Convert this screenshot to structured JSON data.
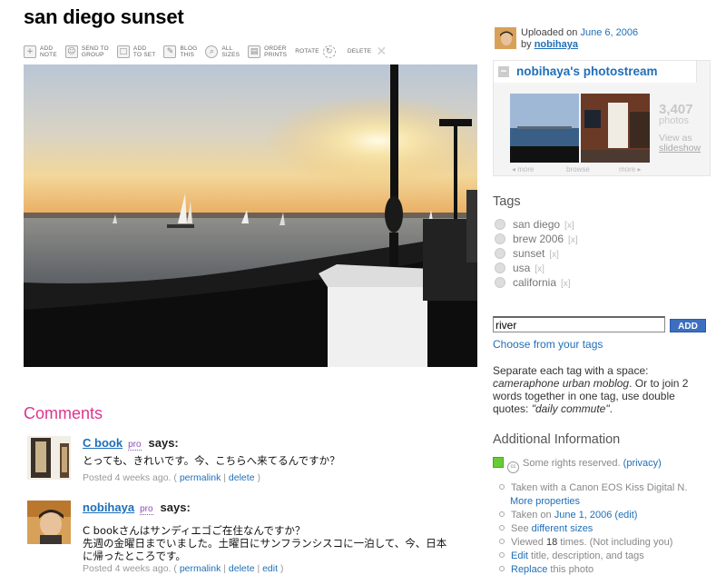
{
  "title": "san diego sunset",
  "toolbar": [
    {
      "icon": "add-note-icon",
      "line1": "ADD",
      "line2": "NOTE"
    },
    {
      "icon": "send-to-group-icon",
      "line1": "SEND TO",
      "line2": "GROUP"
    },
    {
      "icon": "add-to-set-icon",
      "line1": "ADD",
      "line2": "TO SET"
    },
    {
      "icon": "blog-this-icon",
      "line1": "BLOG",
      "line2": "THIS"
    },
    {
      "icon": "all-sizes-icon",
      "line1": "ALL",
      "line2": "SIZES"
    },
    {
      "icon": "order-prints-icon",
      "line1": "ORDER",
      "line2": "PRINTS"
    },
    {
      "icon": "rotate-icon",
      "line1": "ROTATE",
      "line2": ""
    },
    {
      "icon": "delete-icon",
      "line1": "DELETE",
      "line2": ""
    }
  ],
  "comments": {
    "heading": "Comments",
    "items": [
      {
        "user": "C book",
        "pro": "pro",
        "says": "says:",
        "body": "とっても、きれいです。今、こちらへ来てるんですか？",
        "posted": "Posted 4 weeks ago. (",
        "links": [
          "permalink",
          "delete"
        ],
        "close": ")"
      },
      {
        "user": "nobihaya",
        "pro": "pro",
        "says": "says:",
        "body1": "C bookさんはサンディエゴご在住なんですか？",
        "body2": "先週の金曜日までいました。土曜日にサンフランシスコに一泊して、今、日本",
        "body3": "に帰ったところです。",
        "posted": "Posted 4 weeks ago. (",
        "links": [
          "permalink",
          "delete",
          "edit"
        ],
        "close": ")"
      }
    ]
  },
  "uploader": {
    "uploaded_on": "Uploaded on",
    "date": "June 6, 2006",
    "by": "by",
    "user": "nobihaya"
  },
  "photostream": {
    "title": "nobihaya's photostream",
    "count": "3,407",
    "count_label": "photos",
    "view_as": "View as",
    "slideshow": "slideshow",
    "nav_more_left": "◂ more",
    "nav_browse": "browse",
    "nav_more_right": "more ▸"
  },
  "tags": {
    "heading": "Tags",
    "items": [
      "san diego",
      "brew 2006",
      "sunset",
      "usa",
      "california"
    ],
    "remove": "[x]",
    "input_value": "river",
    "add_button": "ADD",
    "choose_link": "Choose from your tags",
    "help_1": "Separate each tag with a space: ",
    "help_example1": "cameraphone urban moblog",
    "help_2": ". Or to join 2 words together in one tag, use double quotes: ",
    "help_example2": "\"daily commute\"",
    "help_3": "."
  },
  "additional": {
    "heading": "Additional Information",
    "rights": "Some rights reserved.",
    "privacy": "(privacy)",
    "camera": "Taken with a Canon EOS Kiss Digital N.",
    "more_props": "More properties",
    "taken_on": "Taken on",
    "taken_date": "June 1, 2006",
    "edit": "(edit)",
    "see": "See",
    "sizes": "different sizes",
    "viewed_pre": "Viewed",
    "viewed_count": "18",
    "viewed_post": "times.  (Not including you)",
    "edit_link": "Edit",
    "edit_rest": "title, description, and tags",
    "replace_link": "Replace",
    "replace_rest": "this photo"
  },
  "colors": {
    "link": "#1f6fb8",
    "comments_heading": "#e0348f",
    "pro_badge": "#8b4fb8",
    "add_button": "#3d6fc0"
  }
}
